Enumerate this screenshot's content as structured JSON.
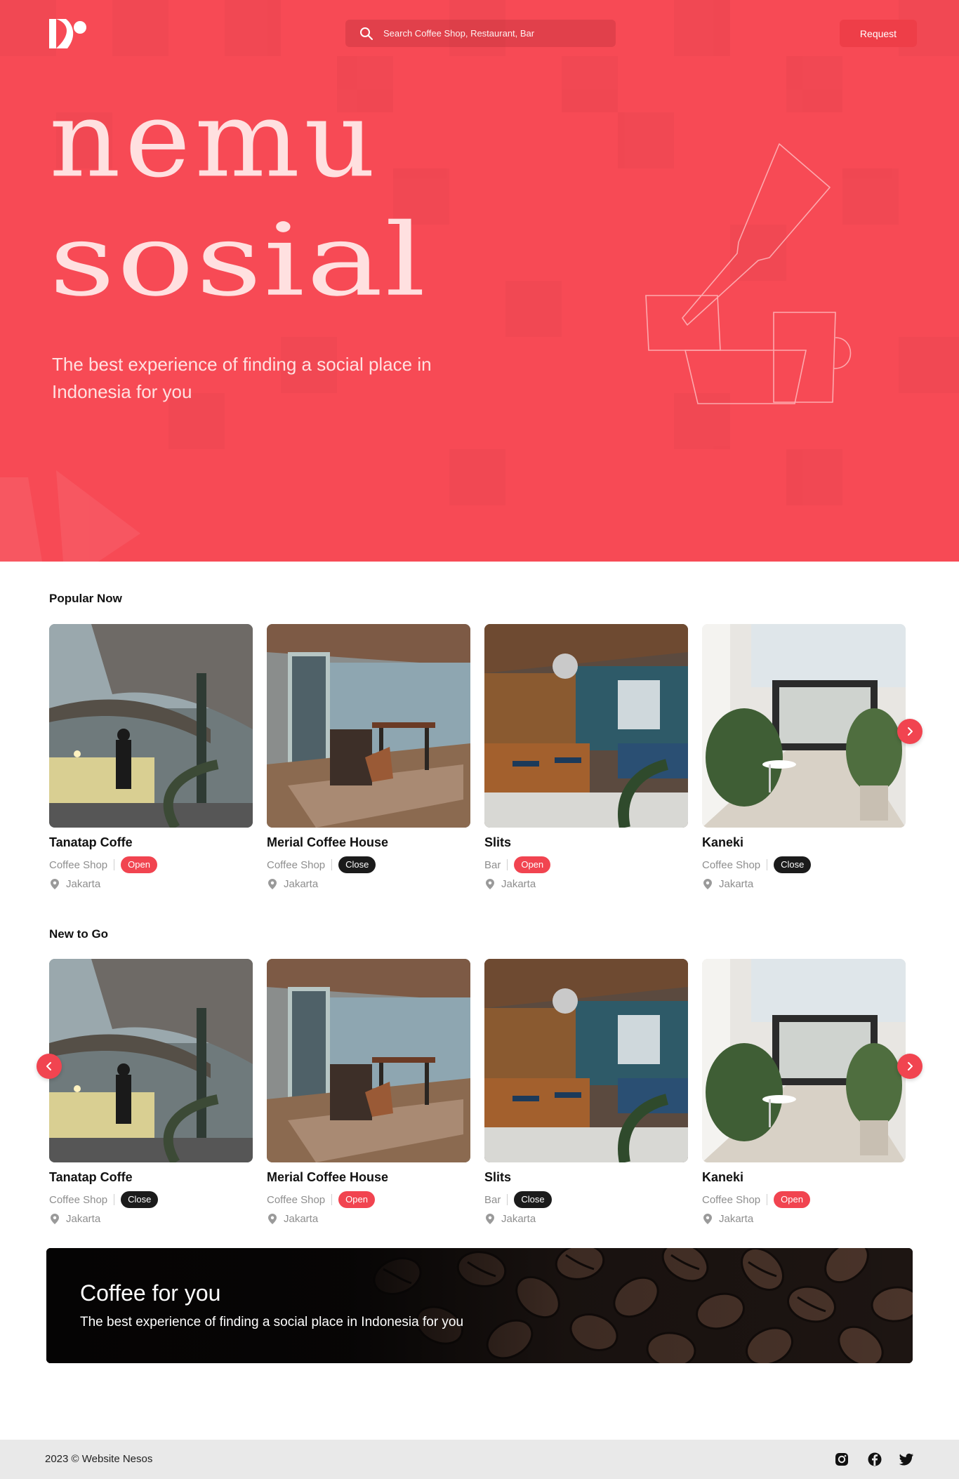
{
  "header": {
    "search": {
      "placeholder": "Search Coffee Shop, Restaurant, Bar",
      "value": ""
    },
    "request_label": "Request"
  },
  "hero": {
    "title_line1": "nemu",
    "title_line2": "sosial",
    "subtitle": "The best experience of finding a social place in Indonesia for you"
  },
  "popular": {
    "title": "Popular Now",
    "cards": [
      {
        "name": "Tanatap Coffe",
        "category": "Coffee Shop",
        "status": "Open",
        "location": "Jakarta"
      },
      {
        "name": "Merial Coffee House",
        "category": "Coffee Shop",
        "status": "Close",
        "location": "Jakarta"
      },
      {
        "name": "Slits",
        "category": "Bar",
        "status": "Open",
        "location": "Jakarta"
      },
      {
        "name": "Kaneki",
        "category": "Coffee Shop",
        "status": "Close",
        "location": "Jakarta"
      }
    ]
  },
  "new_to_go": {
    "title": "New to Go",
    "cards": [
      {
        "name": "Tanatap Coffe",
        "category": "Coffee Shop",
        "status": "Close",
        "location": "Jakarta"
      },
      {
        "name": "Merial Coffee House",
        "category": "Coffee Shop",
        "status": "Open",
        "location": "Jakarta"
      },
      {
        "name": "Slits",
        "category": "Bar",
        "status": "Close",
        "location": "Jakarta"
      },
      {
        "name": "Kaneki",
        "category": "Coffee Shop",
        "status": "Open",
        "location": "Jakarta"
      }
    ]
  },
  "banner": {
    "title": "Coffee for you",
    "subtitle": "The best experience of finding a social place in Indonesia for you"
  },
  "footer": {
    "copyright": "2023 © Website Nesos",
    "social_icons": [
      "instagram-icon",
      "facebook-icon",
      "twitter-icon"
    ]
  },
  "colors": {
    "brand": "#f74a55",
    "open_badge": "#f14450",
    "close_badge": "#1b1b1b",
    "hero_text": "#ffe0e0"
  }
}
